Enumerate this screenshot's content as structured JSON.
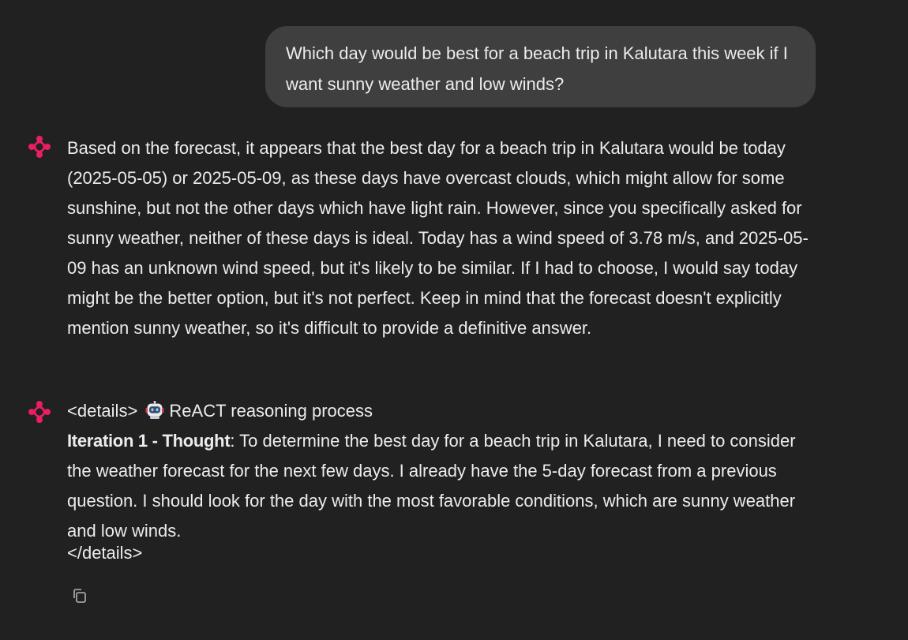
{
  "user_message": {
    "text": "Which day would be best for a beach trip in Kalutara this week if I want sunny weather and low winds?"
  },
  "assistant_message": {
    "text": "Based on the forecast, it appears that the best day for a beach trip in Kalutara would be today (2025-05-05) or 2025-05-09, as these days have overcast clouds, which might allow for some sunshine, but not the other days which have light rain. However, since you specifically asked for sunny weather, neither of these days is ideal. Today has a wind speed of 3.78 m/s, and 2025-05-09 has an unknown wind speed, but it's likely to be similar. If I had to choose, I would say today might be the better option, but it's not perfect. Keep in mind that the forecast doesn't explicitly mention sunny weather, so it's difficult to provide a definitive answer."
  },
  "reasoning_message": {
    "details_open": "<details>",
    "summary": "ReACT reasoning process",
    "iteration_label": "Iteration 1 - Thought",
    "thought_text": ": To determine the best day for a beach trip in Kalutara, I need to consider the weather forecast for the next few days. I already have the 5-day forecast from a previous question. I should look for the day with the most favorable conditions, which are sunny weather and low winds.",
    "details_close": "</details>"
  },
  "icons": {
    "assistant_avatar": "sparkle-logo-icon",
    "robot": "robot-emoji-icon",
    "copy": "copy-icon"
  },
  "colors": {
    "background": "#212121",
    "user_bubble": "#3f3f3f",
    "text": "#ececec",
    "accent": "#e91e63"
  }
}
